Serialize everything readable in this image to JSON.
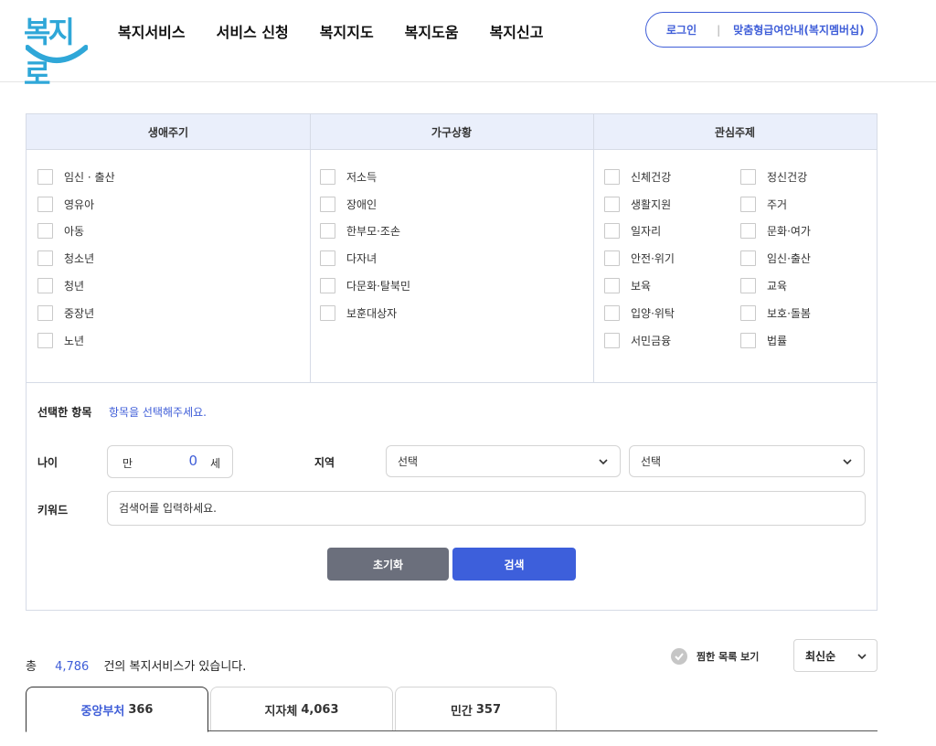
{
  "logo": {
    "text": "복지로"
  },
  "nav": [
    "복지서비스",
    "서비스 신청",
    "복지지도",
    "복지도움",
    "복지신고"
  ],
  "header_right": {
    "login": "로그인",
    "separator": "|",
    "member": "맞춤형급여안내(복지멤버십)"
  },
  "filters": {
    "columns": [
      {
        "title": "생애주기",
        "items": [
          "임신 · 출산",
          "영유아",
          "아동",
          "청소년",
          "청년",
          "중장년",
          "노년"
        ]
      },
      {
        "title": "가구상황",
        "items": [
          "저소득",
          "장애인",
          "한부모·조손",
          "다자녀",
          "다문화·탈북민",
          "보훈대상자"
        ]
      },
      {
        "title": "관심주제",
        "items_left": [
          "신체건강",
          "생활지원",
          "일자리",
          "안전·위기",
          "보육",
          "입양·위탁",
          "서민금융"
        ],
        "items_right": [
          "정신건강",
          "주거",
          "문화·여가",
          "임신·출산",
          "교육",
          "보호·돌봄",
          "법률"
        ]
      }
    ],
    "selected_label": "선택한 항목",
    "selected_hint": "항목을 선택해주세요.",
    "age": {
      "label": "나이",
      "prefix": "만",
      "value": "0",
      "suffix": "세"
    },
    "region": {
      "label": "지역",
      "select1": "선택",
      "select2": "선택"
    },
    "keyword": {
      "label": "키워드",
      "placeholder": "검색어를 입력하세요."
    },
    "buttons": {
      "reset": "초기화",
      "search": "검색"
    }
  },
  "results": {
    "prefix": "총",
    "count": "4,786",
    "suffix": "건의 복지서비스가 있습니다.",
    "fav_label": "찜한 목록 보기",
    "sort": "최신순",
    "tabs": [
      {
        "name": "중앙부처",
        "count": "366",
        "active": true
      },
      {
        "name": "지자체",
        "count": "4,063",
        "active": false
      },
      {
        "name": "민간",
        "count": "357",
        "active": false
      }
    ]
  },
  "colors": {
    "accent": "#3d5fdb",
    "header_bg": "#eaeffb",
    "reset_btn": "#6b6f7c",
    "logo": "#2fa7d8"
  }
}
